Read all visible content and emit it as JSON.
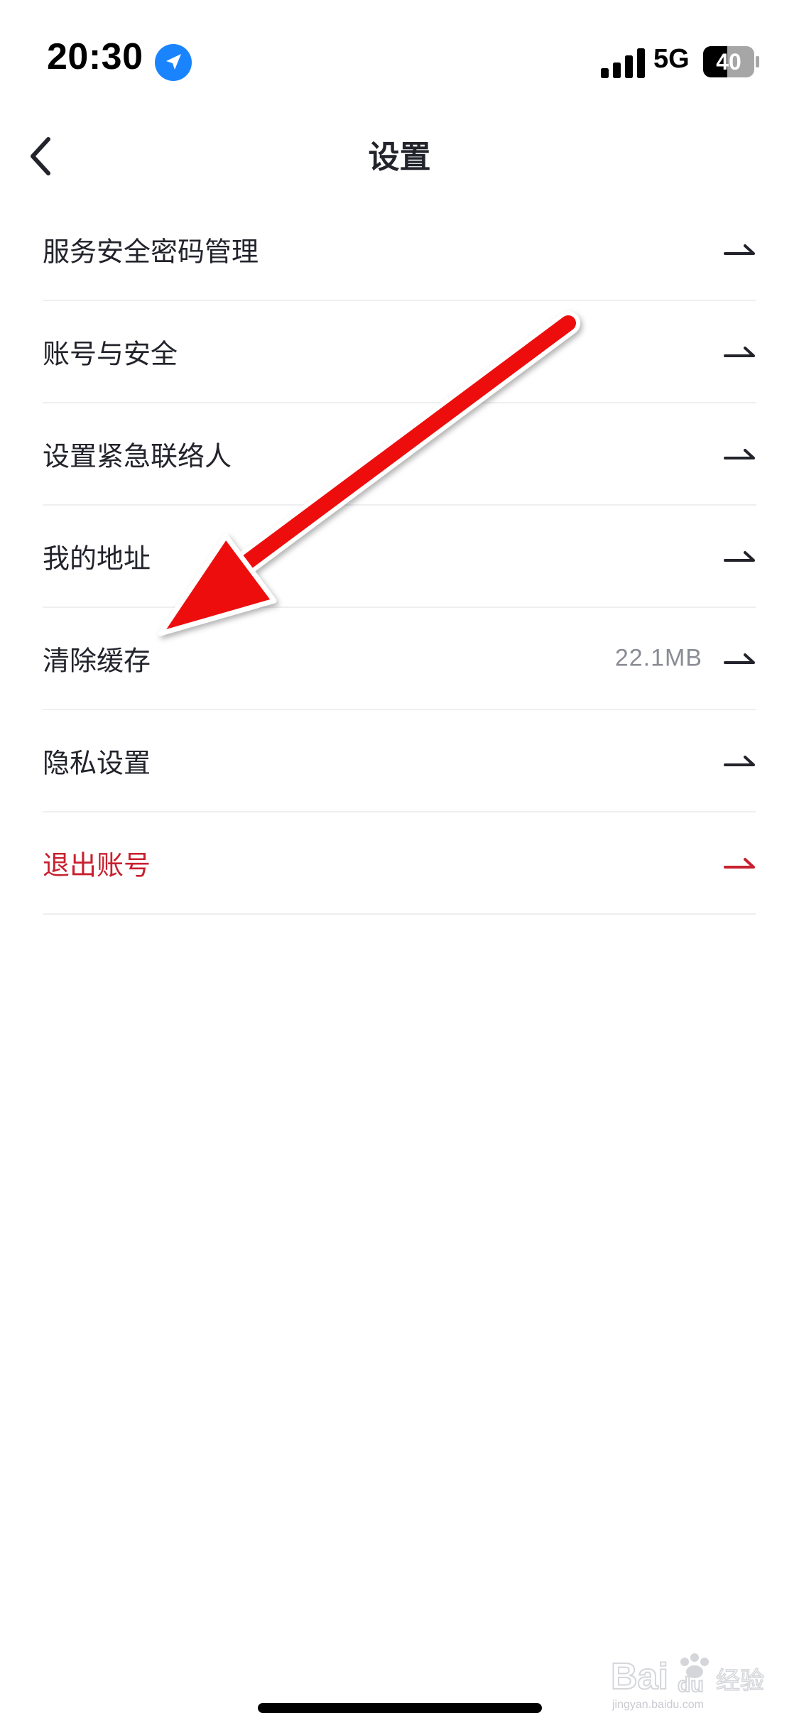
{
  "status_bar": {
    "time": "20:30",
    "network": "5G",
    "battery_level": "40"
  },
  "nav": {
    "title": "设置"
  },
  "settings": {
    "items": [
      {
        "label": "服务安全密码管理",
        "value": ""
      },
      {
        "label": "账号与安全",
        "value": ""
      },
      {
        "label": "设置紧急联络人",
        "value": ""
      },
      {
        "label": "我的地址",
        "value": ""
      },
      {
        "label": "清除缓存",
        "value": "22.1MB"
      },
      {
        "label": "隐私设置",
        "value": ""
      },
      {
        "label": "退出账号",
        "value": ""
      }
    ]
  },
  "watermark": {
    "sub": "jingyan.baidu.com"
  },
  "colors": {
    "text_primary": "#22232b",
    "text_secondary": "#8a8c94",
    "danger": "#c8202f",
    "divider": "#eeeff1",
    "annotation_red": "#ee1111",
    "location_blue": "#1a84ff"
  },
  "icons": {
    "back": "chevron-left-icon",
    "row_arrow": "arrow-right-icon",
    "location": "location-arrow-icon",
    "signal": "cellular-signal-icon",
    "battery": "battery-icon"
  }
}
